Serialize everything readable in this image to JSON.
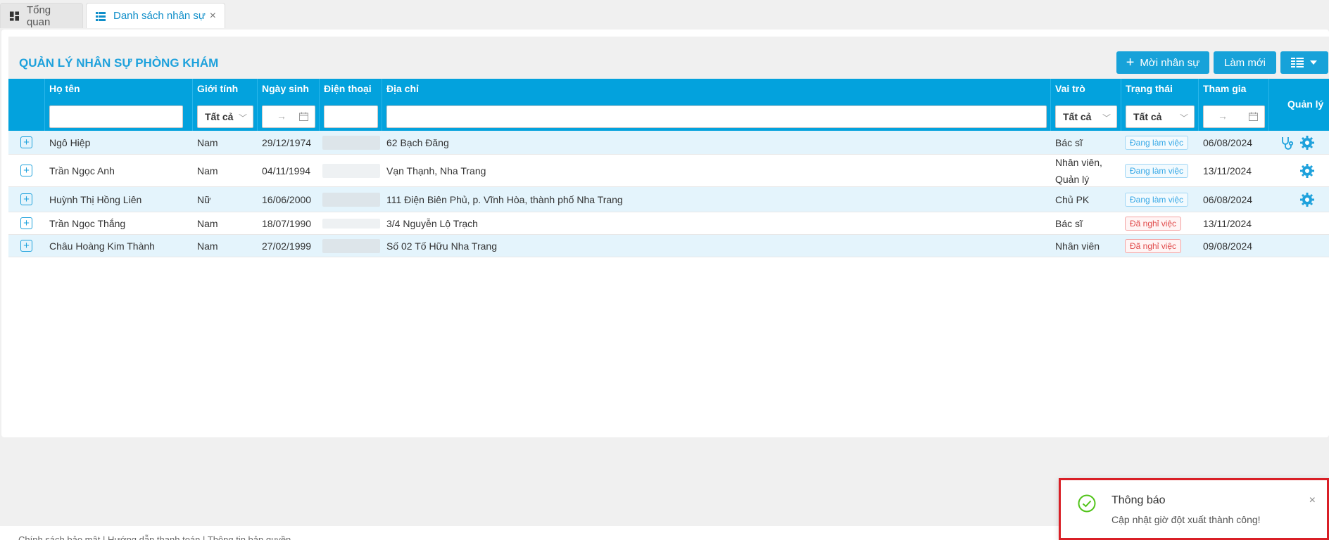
{
  "tabs": [
    {
      "label": "Tổng quan"
    },
    {
      "label": "Danh sách nhân sự",
      "close": "×"
    }
  ],
  "page_title": "QUẢN LÝ NHÂN SỰ PHÒNG KHÁM",
  "toolbar": {
    "new_label": "Mời nhân sự",
    "refresh_label": "Làm mới"
  },
  "columns": {
    "name": "Họ tên",
    "gender": "Giới tính",
    "dob": "Ngày sinh",
    "phone": "Điện thoại",
    "address": "Địa chỉ",
    "role": "Vai trò",
    "status": "Trạng thái",
    "joined": "Tham gia",
    "manage": "Quản lý"
  },
  "filters": {
    "gender": "Tất cả",
    "role": "Tất cả",
    "status": "Tất cả",
    "date_arrow": "→"
  },
  "rows": [
    {
      "name": "Ngô Hiệp",
      "gender": "Nam",
      "dob": "29/12/1974",
      "address": "62 Bạch Đăng",
      "role": "Bác sĩ",
      "status": "Đang làm việc",
      "joined": "06/08/2024"
    },
    {
      "name": "Trần Ngọc Anh",
      "gender": "Nam",
      "dob": "04/11/1994",
      "address": "Vạn Thạnh, Nha Trang",
      "role_line1": "Nhân viên,",
      "role_line2": "Quản lý",
      "status": "Đang làm việc",
      "joined": "13/11/2024"
    },
    {
      "name": "Huỳnh Thị Hồng Liên",
      "gender": "Nữ",
      "dob": "16/06/2000",
      "address": "111 Điện Biên Phủ, p. Vĩnh Hòa, thành phố Nha Trang",
      "role": "Chủ PK",
      "status": "Đang làm việc",
      "joined": "06/08/2024"
    },
    {
      "name": "Trần Ngọc Thắng",
      "gender": "Nam",
      "dob": "18/07/1990",
      "address": "3/4 Nguyễn Lộ Trạch",
      "role": "Bác sĩ",
      "status": "Đã nghỉ việc",
      "joined": "13/11/2024"
    },
    {
      "name": "Châu Hoàng Kim Thành",
      "gender": "Nam",
      "dob": "27/02/1999",
      "address": "Số 02 Tố Hữu Nha Trang",
      "role": "Nhân viên",
      "status": "Đã nghỉ việc",
      "joined": "09/08/2024"
    }
  ],
  "expand_symbol": "+",
  "footer": "Chính sách bảo mật  |  Hướng dẫn thanh toán  |  Thông tin bản quyền",
  "notification": {
    "title": "Thông báo",
    "message": "Cập nhật giờ đột xuất thành công!",
    "close": "×"
  },
  "colors": {
    "primary": "#03a2dd",
    "active_status": "#37a8e6",
    "inactive_status": "#e04a4a",
    "success": "#52c41a",
    "highlight_border": "#d91f26"
  }
}
